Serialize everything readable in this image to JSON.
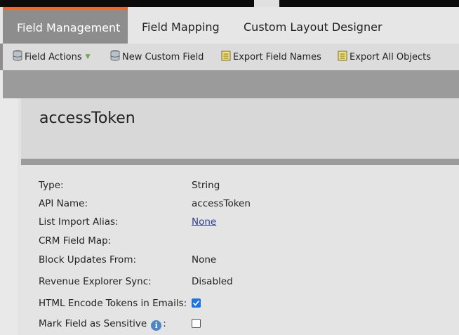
{
  "tabs": [
    "Field Management",
    "Field Mapping",
    "Custom Layout Designer"
  ],
  "toolbar": {
    "field_actions": "Field Actions",
    "new_custom_field": "New Custom Field",
    "export_field_names": "Export Field Names",
    "export_all_objects": "Export All Objects"
  },
  "field": {
    "title": "accessToken",
    "rows": [
      {
        "label": "Type:",
        "value": "String"
      },
      {
        "label": "API Name:",
        "value": "accessToken"
      },
      {
        "label": "List Import Alias:",
        "value": "None"
      },
      {
        "label": "CRM Field Map:",
        "value": ""
      },
      {
        "label": "Block Updates From:",
        "value": "None"
      },
      {
        "label": "Revenue Explorer Sync:",
        "value": "Disabled"
      },
      {
        "label": "HTML Encode Tokens in Emails:",
        "checked": true
      },
      {
        "label": "Mark Field as Sensitive",
        "suffix": ":",
        "checked": false
      }
    ]
  },
  "colors": {
    "accent": "#f06a26",
    "checkbox": "#1a73e8",
    "link": "#2f3f8f"
  }
}
